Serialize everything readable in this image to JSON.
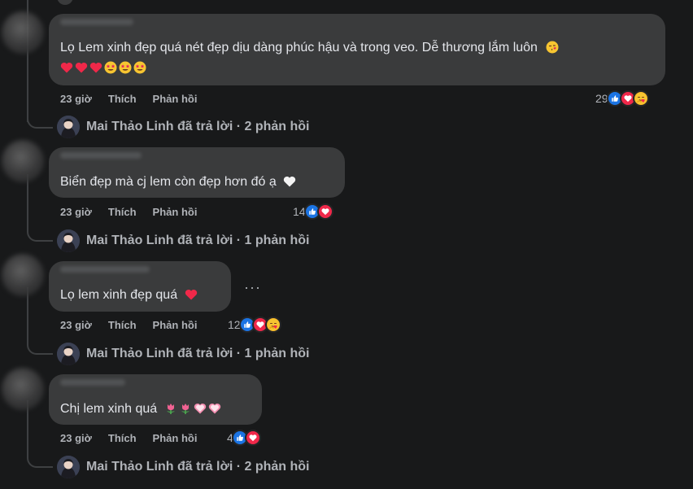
{
  "comments": [
    {
      "text": "Lọ Lem xinh đẹp quá nét đẹp dịu dàng phúc hậu và trong veo. Dễ thương lắm luôn",
      "emoji_line": [
        "heart",
        "heart",
        "heart",
        "star-struck",
        "star-struck",
        "star-struck"
      ],
      "time": "23 giờ",
      "like_label": "Thích",
      "reply_label": "Phản hồi",
      "reaction_count": "29",
      "reactions": [
        "like",
        "love",
        "care"
      ],
      "replies": "Mai Thảo Linh đã trả lời · 2 phản hồi"
    },
    {
      "text": "Biển đẹp mà cj lem còn đẹp hơn đó ạ",
      "time": "23 giờ",
      "like_label": "Thích",
      "reply_label": "Phản hồi",
      "reaction_count": "14",
      "reactions": [
        "like",
        "love"
      ],
      "replies": "Mai Thảo Linh đã trả lời · 1 phản hồi"
    },
    {
      "text": "Lọ lem xinh đẹp quá",
      "time": "23 giờ",
      "like_label": "Thích",
      "reply_label": "Phản hồi",
      "reaction_count": "12",
      "reactions": [
        "like",
        "love",
        "care"
      ],
      "replies": "Mai Thảo Linh đã trả lời · 1 phản hồi"
    },
    {
      "text": "Chị lem xinh quá",
      "time": "23 giờ",
      "like_label": "Thích",
      "reply_label": "Phản hồi",
      "reaction_count": "4",
      "reactions": [
        "like",
        "love"
      ],
      "replies": "Mai Thảo Linh đã trả lời · 2 phản hồi"
    }
  ],
  "more_label": "···",
  "colors": {
    "background": "#18191a",
    "bubble": "#3a3b3c",
    "text": "#e4e6eb",
    "muted": "#b0b3b8",
    "like": "#1b74e4",
    "love": "#f0284a",
    "care": "#f7b928"
  }
}
